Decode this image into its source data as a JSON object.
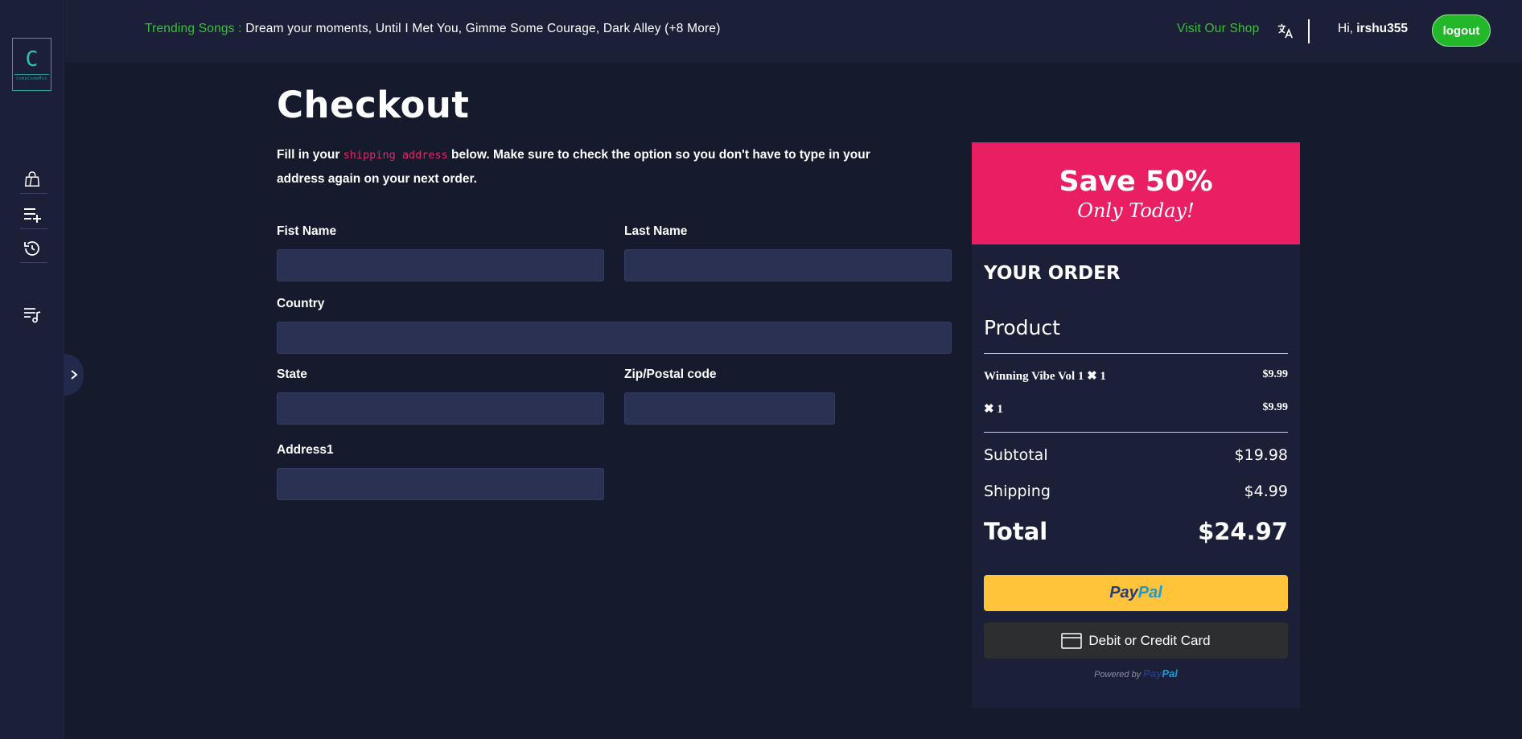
{
  "sidebar": {
    "logo": {
      "letter": "C",
      "subtitle": "CompCodeMix"
    },
    "icons": [
      "shopping-bag-icon",
      "add-to-playlist-icon",
      "history-icon",
      "music-queue-icon",
      "chevron-right-icon"
    ]
  },
  "topbar": {
    "trending_label": "Trending Songs : ",
    "trending_songs": "Dream your moments, Until I Met You, Gimme Some Courage, Dark Alley (+8 More)",
    "visit_shop": "Visit Our Shop",
    "greeting_prefix": "Hi, ",
    "username": "irshu355",
    "logout_label": "logout"
  },
  "checkout": {
    "title": "Checkout",
    "intro_before": "Fill in your ",
    "intro_code": "shipping address",
    "intro_after": " below. Make sure to check the option so you don't have to type in your address again on your next order.",
    "fields": {
      "first_name_label": "Fist Name",
      "first_name_value": "",
      "last_name_label": "Last Name",
      "last_name_value": "",
      "country_label": "Country",
      "country_value": "",
      "state_label": "State",
      "state_value": "",
      "zip_label": "Zip/Postal code",
      "zip_value": "",
      "address1_label": "Address1",
      "address1_value": ""
    }
  },
  "order": {
    "promo_title": "Save 50%",
    "promo_subtitle": "Only Today!",
    "heading": "YOUR ORDER",
    "product_heading": "Product",
    "items": [
      {
        "name": "Winning Vibe Vol 1 ✖ 1",
        "price": "$9.99"
      },
      {
        "name": "✖ 1",
        "price": "$9.99"
      }
    ],
    "subtotal_label": "Subtotal",
    "subtotal_value": "$19.98",
    "shipping_label": "Shipping",
    "shipping_value": "$4.99",
    "total_label": "Total",
    "total_value": "$24.97",
    "paypal_pay": "Pay",
    "paypal_pal": "Pal",
    "card_label": "Debit or Credit Card",
    "powered_by": "Powered by "
  },
  "colors": {
    "background": "#151a2c",
    "panel": "#1b2038",
    "accent_green": "#3cbf3c",
    "promo_pink": "#ea1e63",
    "paypal_yellow": "#ffc439"
  }
}
